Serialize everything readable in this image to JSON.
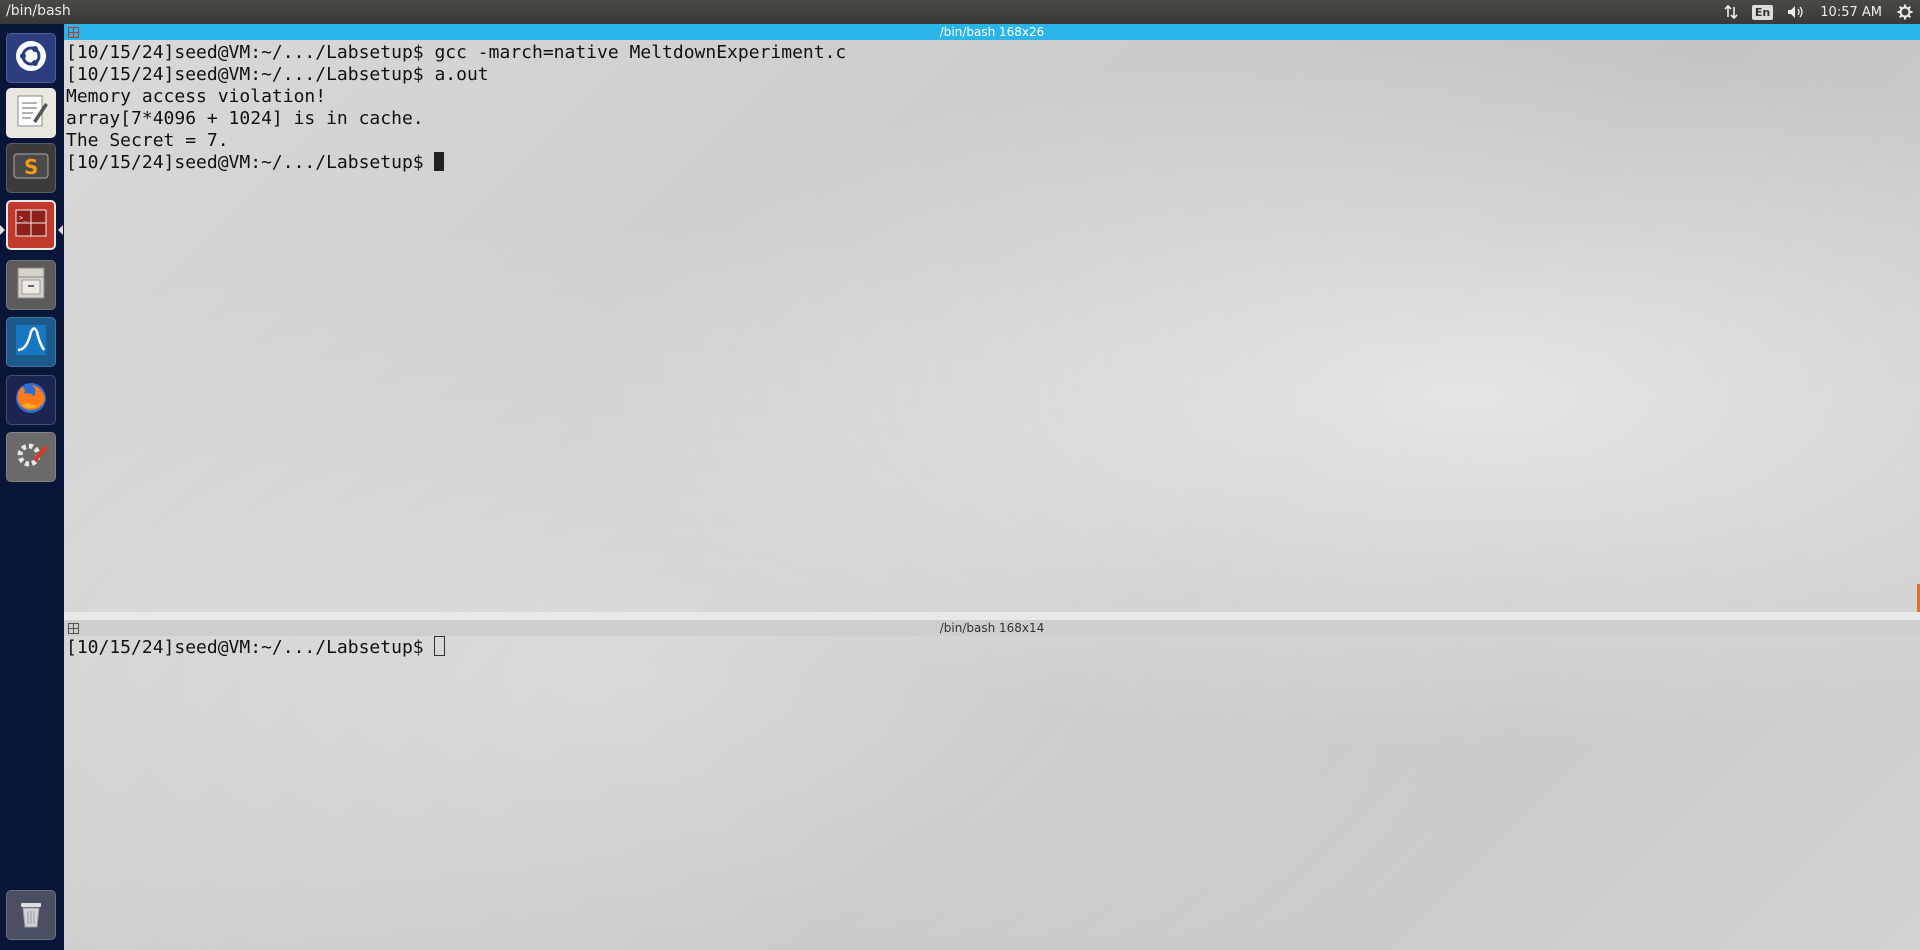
{
  "top_panel": {
    "window_title": "/bin/bash",
    "language": "En",
    "clock": "10:57 AM"
  },
  "launcher": {
    "items": [
      {
        "name": "ubuntu-dash",
        "icon": "ubuntu-logo-icon"
      },
      {
        "name": "text-editor",
        "icon": "text-editor-icon"
      },
      {
        "name": "sublime-text",
        "icon": "sublime-text-icon"
      },
      {
        "name": "terminator",
        "icon": "terminator-icon"
      },
      {
        "name": "files",
        "icon": "file-cabinet-icon"
      },
      {
        "name": "wireshark",
        "icon": "wireshark-icon"
      },
      {
        "name": "firefox",
        "icon": "firefox-icon"
      },
      {
        "name": "system-settings",
        "icon": "settings-gear-icon"
      },
      {
        "name": "trash",
        "icon": "trash-icon"
      }
    ]
  },
  "pane1": {
    "title": "/bin/bash 168x26",
    "lines": [
      "[10/15/24]seed@VM:~/.../Labsetup$ gcc -march=native MeltdownExperiment.c",
      "[10/15/24]seed@VM:~/.../Labsetup$ a.out",
      "Memory access violation!",
      "array[7*4096 + 1024] is in cache.",
      "The Secret = 7."
    ],
    "prompt": "[10/15/24]seed@VM:~/.../Labsetup$ "
  },
  "pane2": {
    "title": "/bin/bash 168x14",
    "prompt": "[10/15/24]seed@VM:~/.../Labsetup$ "
  },
  "colors": {
    "active_titlebar": "#2bb4e8",
    "inactive_titlebar": "#cfcdcd",
    "launcher_bg": "#091539"
  }
}
